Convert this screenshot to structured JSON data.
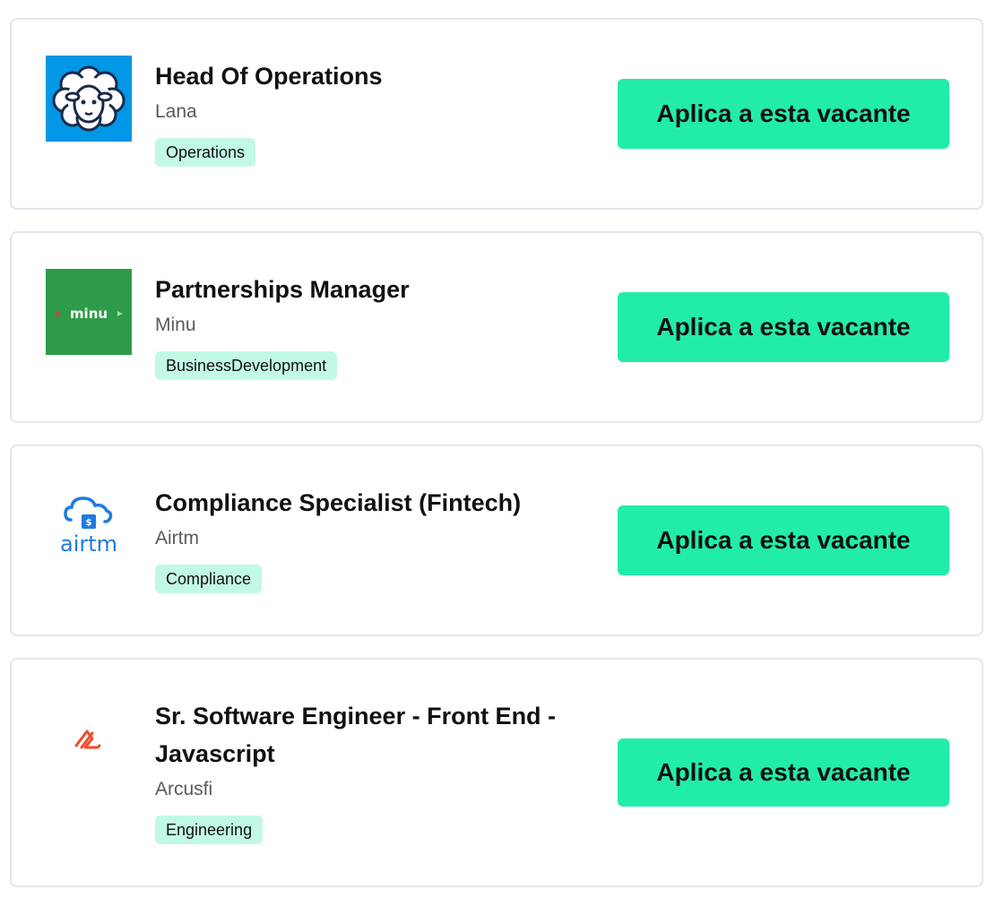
{
  "jobs": [
    {
      "title": "Head Of Operations",
      "company": "Lana",
      "tag": "Operations",
      "apply_label": "Aplica a esta vacante",
      "logo_icon": "sheep-icon",
      "logo_color": "#0097e6"
    },
    {
      "title": "Partnerships Manager",
      "company": "Minu",
      "tag": "BusinessDevelopment",
      "apply_label": "Aplica a esta vacante",
      "logo_icon": "minu-logo",
      "logo_text": "minu",
      "logo_color": "#2e9b48"
    },
    {
      "title": "Compliance Specialist (Fintech)",
      "company": "Airtm",
      "tag": "Compliance",
      "apply_label": "Aplica a esta vacante",
      "logo_icon": "cloud-dollar-icon",
      "logo_text": "airtm",
      "logo_color": "#1e7be0"
    },
    {
      "title": "Sr. Software Engineer - Front End - Javascript",
      "company": "Arcusfi",
      "tag": "Engineering",
      "apply_label": "Aplica a esta vacante",
      "logo_icon": "arcus-logo",
      "logo_color": "#f04a2a"
    }
  ],
  "colors": {
    "accent": "#22eda8",
    "tag_bg": "#c2f9e4",
    "border": "#e3e5ec"
  }
}
